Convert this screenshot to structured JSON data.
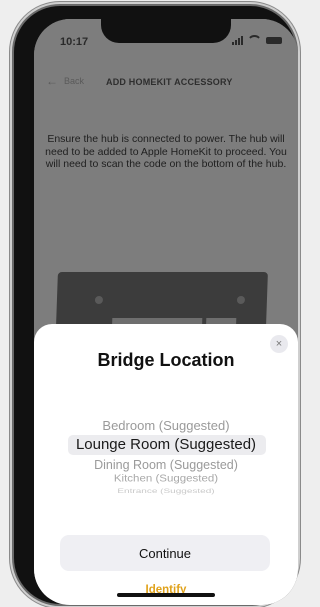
{
  "status": {
    "time": "10:17",
    "location_arrow": "location-arrow-icon"
  },
  "nav": {
    "back_label": "Back",
    "title": "ADD HOMEKIT ACCESSORY"
  },
  "instructions": "Ensure the hub is connected to power. The hub will need to be added to Apple HomeKit to proceed. You will need to scan the code on the bottom of the hub.",
  "sheet": {
    "title": "Bridge Location",
    "close_label": "×",
    "picker_options": [
      "Bedroom (Suggested)",
      "Lounge Room (Suggested)",
      "Dining Room (Suggested)",
      "Kitchen (Suggested)",
      "Entrance (Suggested)"
    ],
    "selected_option": "Lounge Room (Suggested)",
    "continue_label": "Continue",
    "identify_label": "Identify"
  },
  "colors": {
    "accent": "#e0a21b",
    "overlay": "#7d7d7d",
    "sheet": "#ffffff"
  }
}
